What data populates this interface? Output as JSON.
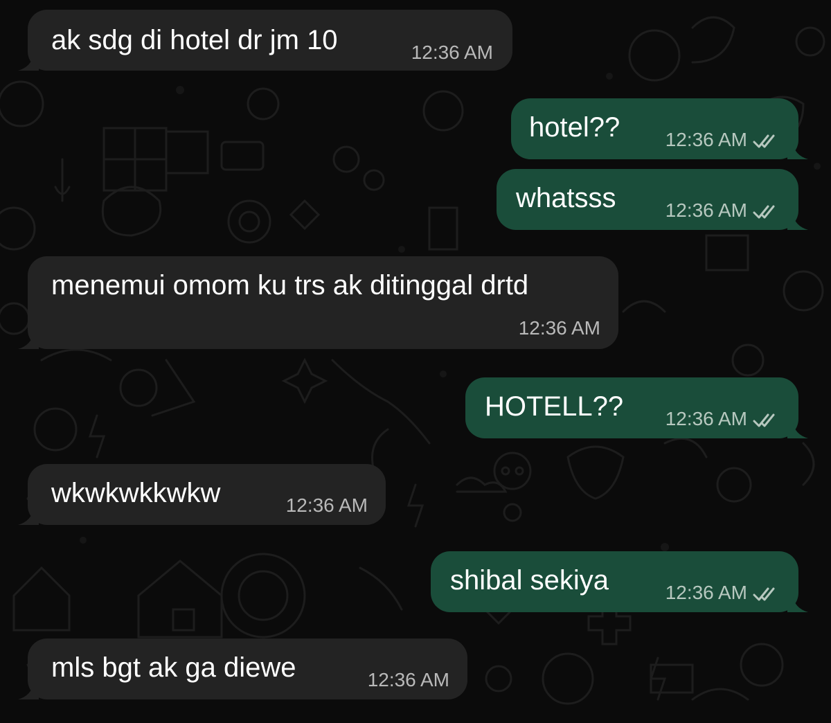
{
  "messages": [
    {
      "direction": "incoming",
      "text": "ak sdg di hotel dr jm 10",
      "time": "12:36 AM"
    },
    {
      "direction": "outgoing",
      "text": "hotel??",
      "time": "12:36 AM",
      "status_icon": "double-check-icon"
    },
    {
      "direction": "outgoing",
      "text": "whatsss",
      "time": "12:36 AM",
      "status_icon": "double-check-icon"
    },
    {
      "direction": "incoming",
      "text": "menemui omom ku trs ak ditinggal drtd",
      "time": "12:36 AM"
    },
    {
      "direction": "outgoing",
      "text": "HOTELL??",
      "time": "12:36 AM",
      "status_icon": "double-check-icon"
    },
    {
      "direction": "incoming",
      "text": "wkwkwkkwkw",
      "time": "12:36 AM"
    },
    {
      "direction": "outgoing",
      "text": "shibal sekiya",
      "time": "12:36 AM",
      "status_icon": "double-check-icon"
    },
    {
      "direction": "incoming",
      "text": "mls bgt ak ga diewe",
      "time": "12:36 AM"
    }
  ],
  "colors": {
    "background": "#0b0b0b",
    "incoming_bubble": "#232323",
    "outgoing_bubble": "#1a4d3a",
    "text": "#ffffff",
    "meta_text": "#b9b9b9"
  }
}
